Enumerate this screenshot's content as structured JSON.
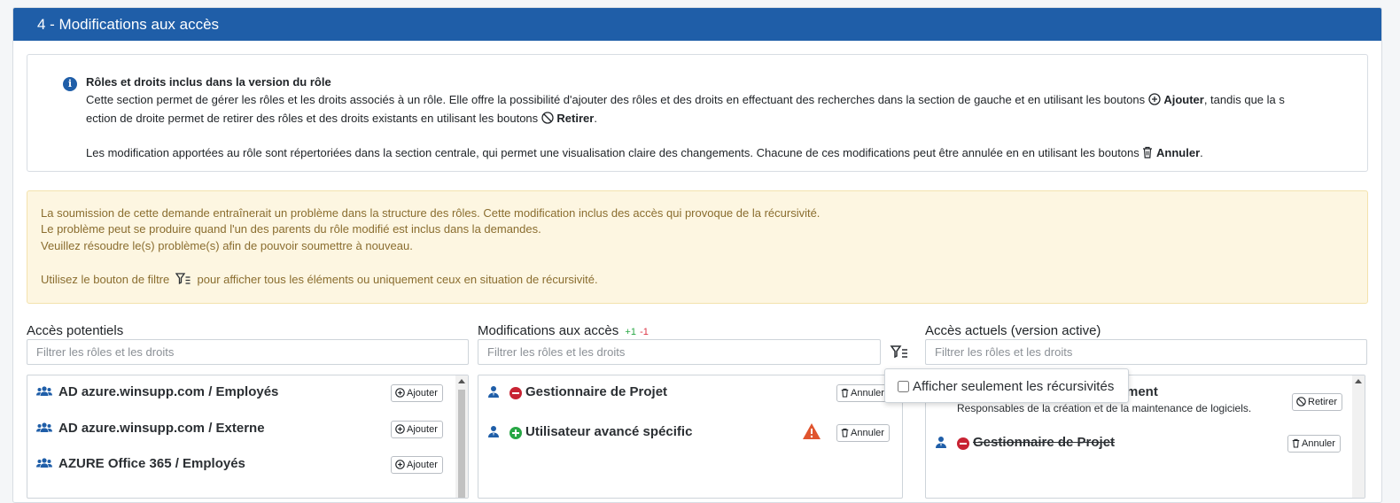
{
  "section": {
    "title": "4 - Modifications aux accès"
  },
  "info": {
    "title": "Rôles et droits inclus dans la version du rôle",
    "p1_a": "Cette section permet de gérer les rôles et les droits associés à un rôle. Elle offre la possibilité d'ajouter des rôles et des droits en effectuant des recherches dans la section de gauche et en utilisant les boutons ",
    "p1_ajouter": "Ajouter",
    "p1_b": ", tandis que la s",
    "p1_c": "ection de droite permet de retirer des rôles et des droits existants en utilisant les boutons ",
    "p1_retirer": "Retirer",
    "p1_end": ".",
    "p2_a": "Les modification apportées au rôle sont répertoriées dans la section centrale, qui permet une visualisation claire des changements. Chacune de ces modifications peut être annulée en en utilisant les boutons ",
    "p2_annuler": "Annuler",
    "p2_end": "."
  },
  "warning": {
    "line1": "La soumission de cette demande entraînerait un problème dans la structure des rôles. Cette modification inclus des accès qui provoque de la récursivité.",
    "line2": "Le problème peut se produire quand l'un des parents du rôle modifié est inclus dans la demandes.",
    "line3": "Veuillez résoudre le(s) problème(s) afin de pouvoir soumettre à nouveau.",
    "line4_a": "Utilisez le bouton de filtre",
    "line4_b": "pour afficher tous les éléments ou uniquement ceux en situation de récursivité."
  },
  "potential": {
    "title": "Accès potentiels",
    "placeholder": "Filtrer les rôles et les droits",
    "items": [
      {
        "label": "AD azure.winsupp.com / Employés",
        "button": "Ajouter"
      },
      {
        "label": "AD azure.winsupp.com / Externe",
        "button": "Ajouter"
      },
      {
        "label": "AZURE Office 365 / Employés",
        "button": "Ajouter"
      }
    ]
  },
  "modifications": {
    "title": "Modifications aux accès",
    "plus": "+1",
    "minus": "-1",
    "placeholder": "Filtrer les rôles et les droits",
    "items": [
      {
        "label": "Gestionnaire de Projet",
        "status": "removed",
        "button": "Annuler"
      },
      {
        "label": "Utilisateur avancé spécific",
        "status": "added",
        "warning": true,
        "button": "Annuler"
      }
    ]
  },
  "filter_popup": {
    "label": "Afficher seulement les récursivités",
    "checked": false
  },
  "current": {
    "title": "Accès actuels (version active)",
    "placeholder": "Filtrer les rôles et les droits",
    "items": [
      {
        "label_partial": "ment",
        "description": "Responsables de la création et de la maintenance de logiciels.",
        "button": "Retirer"
      },
      {
        "label": "Gestionnaire de Projet",
        "status": "removed",
        "button": "Annuler"
      }
    ]
  },
  "colors": {
    "header": "#1f5ea8",
    "warning_bg": "#fdf6e1",
    "warning_text": "#8a6d2f",
    "plus": "#28a745",
    "minus": "#dc3545"
  }
}
